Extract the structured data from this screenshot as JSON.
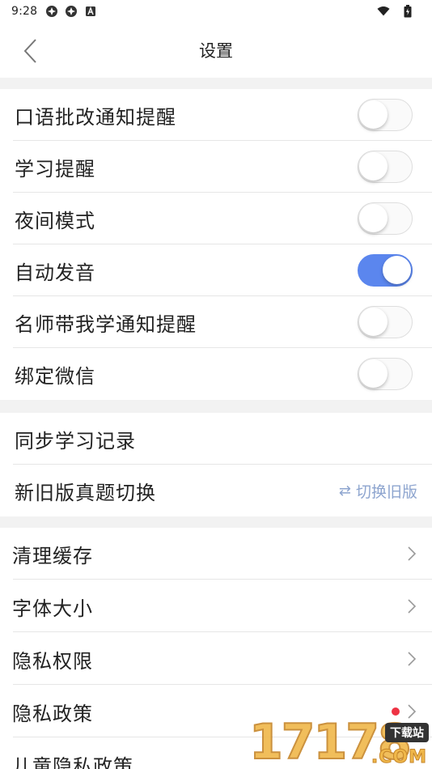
{
  "status_bar": {
    "time": "9:28"
  },
  "nav": {
    "title": "设置"
  },
  "section1": [
    {
      "label": "口语批改通知提醒",
      "enabled": false
    },
    {
      "label": "学习提醒",
      "enabled": false
    },
    {
      "label": "夜间模式",
      "enabled": false
    },
    {
      "label": "自动发音",
      "enabled": true
    },
    {
      "label": "名师带我学通知提醒",
      "enabled": false
    },
    {
      "label": "绑定微信",
      "enabled": false
    }
  ],
  "section2": {
    "sync_label": "同步学习记录",
    "version_label": "新旧版真题切换",
    "version_action": "切换旧版",
    "version_action_icon": "swap-arrows-icon"
  },
  "section3": [
    {
      "label": "清理缓存",
      "badge": false
    },
    {
      "label": "字体大小",
      "badge": false
    },
    {
      "label": "隐私权限",
      "badge": false
    },
    {
      "label": "隐私政策",
      "badge": true
    },
    {
      "label": "儿童隐私政策",
      "badge": false
    }
  ],
  "watermark": {
    "number": "17178",
    "badge": "下载站",
    "domain": ".COM"
  },
  "colors": {
    "accent": "#5b86ee",
    "link": "#8ea5cf",
    "badge_dot": "#ee3344",
    "section_gap": "#f2f2f2"
  }
}
